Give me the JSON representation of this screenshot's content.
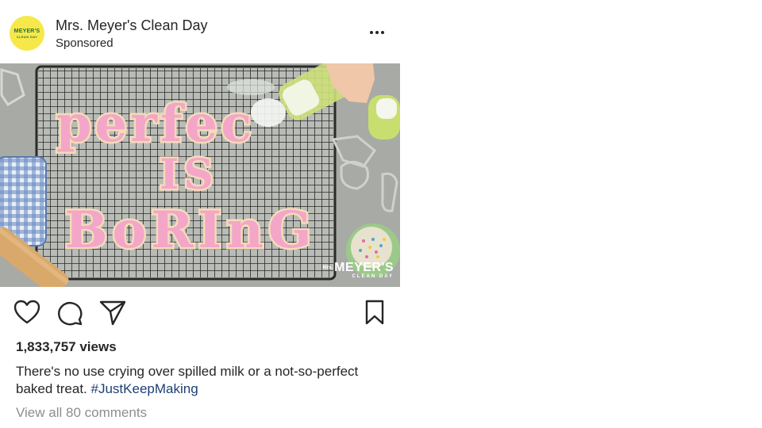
{
  "header": {
    "account_name": "Mrs. Meyer's Clean Day",
    "subtitle": "Sponsored",
    "avatar_line1": "MEYER'S",
    "avatar_line2": "CLEAN DAY",
    "more_icon": "more-horizontal-icon"
  },
  "media": {
    "word1": "perfec",
    "word2": "IS",
    "word3": "BoRInG",
    "watermark_small": "Mrs.",
    "watermark_big": "MEYER'S",
    "watermark_sub": "CLEAN DAY"
  },
  "actions": {
    "like_icon": "heart-icon",
    "comment_icon": "comment-bubble-icon",
    "share_icon": "paper-plane-icon",
    "save_icon": "bookmark-icon"
  },
  "views": "1,833,757 views",
  "caption": {
    "text": "There's no use crying over spilled milk or a not-so-perfect baked treat. ",
    "hashtag": "#JustKeepMaking"
  },
  "comments_link": "View all 80 comments",
  "colors": {
    "avatar_bg": "#f7e84a",
    "frosting_pink": "#f4a6c8",
    "hashtag_blue": "#1d3f75",
    "muted_gray": "#8e8e8e"
  }
}
